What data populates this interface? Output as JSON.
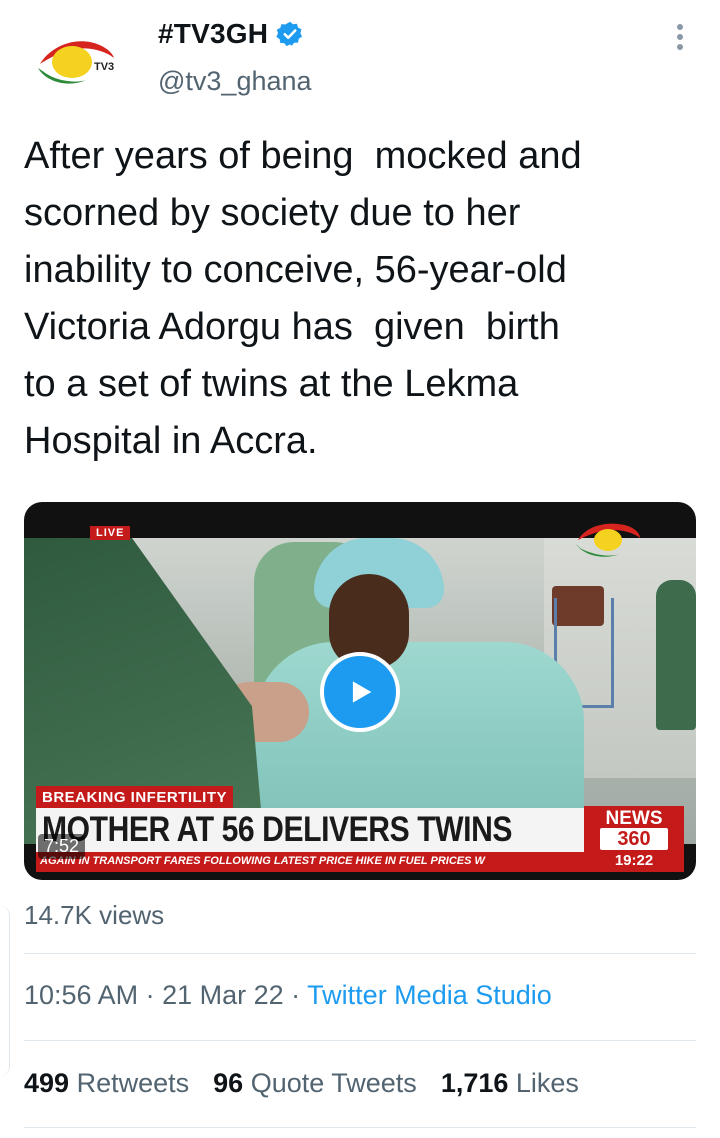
{
  "author": {
    "display_name": "#TV3GH",
    "handle": "@tv3_ghana",
    "avatar_icon": "tv3-logo-icon",
    "avatar_text": "TV3",
    "verified_icon": "verified-badge-icon",
    "more_icon": "more-vertical-icon"
  },
  "tweet": {
    "text": "After years of being  mocked and\nscorned by society due to her\ninability to conceive, 56-year-old\nVictoria Adorgu has  given  birth\nto a set of twins at the Lekma\nHospital in Accra."
  },
  "video": {
    "live_tag": "LIVE",
    "breaking_label": "BREAKING INFERTILITY",
    "headline": "MOTHER AT 56 DELIVERS TWINS",
    "ticker": "AGAIN IN TRANSPORT FARES FOLLOWING LATEST PRICE HIKE IN FUEL PRICES     W",
    "news_label": "NEWS",
    "news_number": "360",
    "broadcast_time": "19:22",
    "duration": "7:52",
    "play_icon": "play-icon"
  },
  "views": "14.7K views",
  "meta": {
    "time": "10:56 AM",
    "date": "21 Mar 22",
    "separator": " · ",
    "source": "Twitter Media Studio"
  },
  "stats": {
    "retweets_count": "499",
    "retweets_label": "Retweets",
    "quotes_count": "96",
    "quotes_label": "Quote Tweets",
    "likes_count": "1,716",
    "likes_label": "Likes"
  },
  "colors": {
    "accent": "#1d9bf0",
    "secondary_text": "#536471",
    "broadcast_red": "#c41a1a"
  }
}
